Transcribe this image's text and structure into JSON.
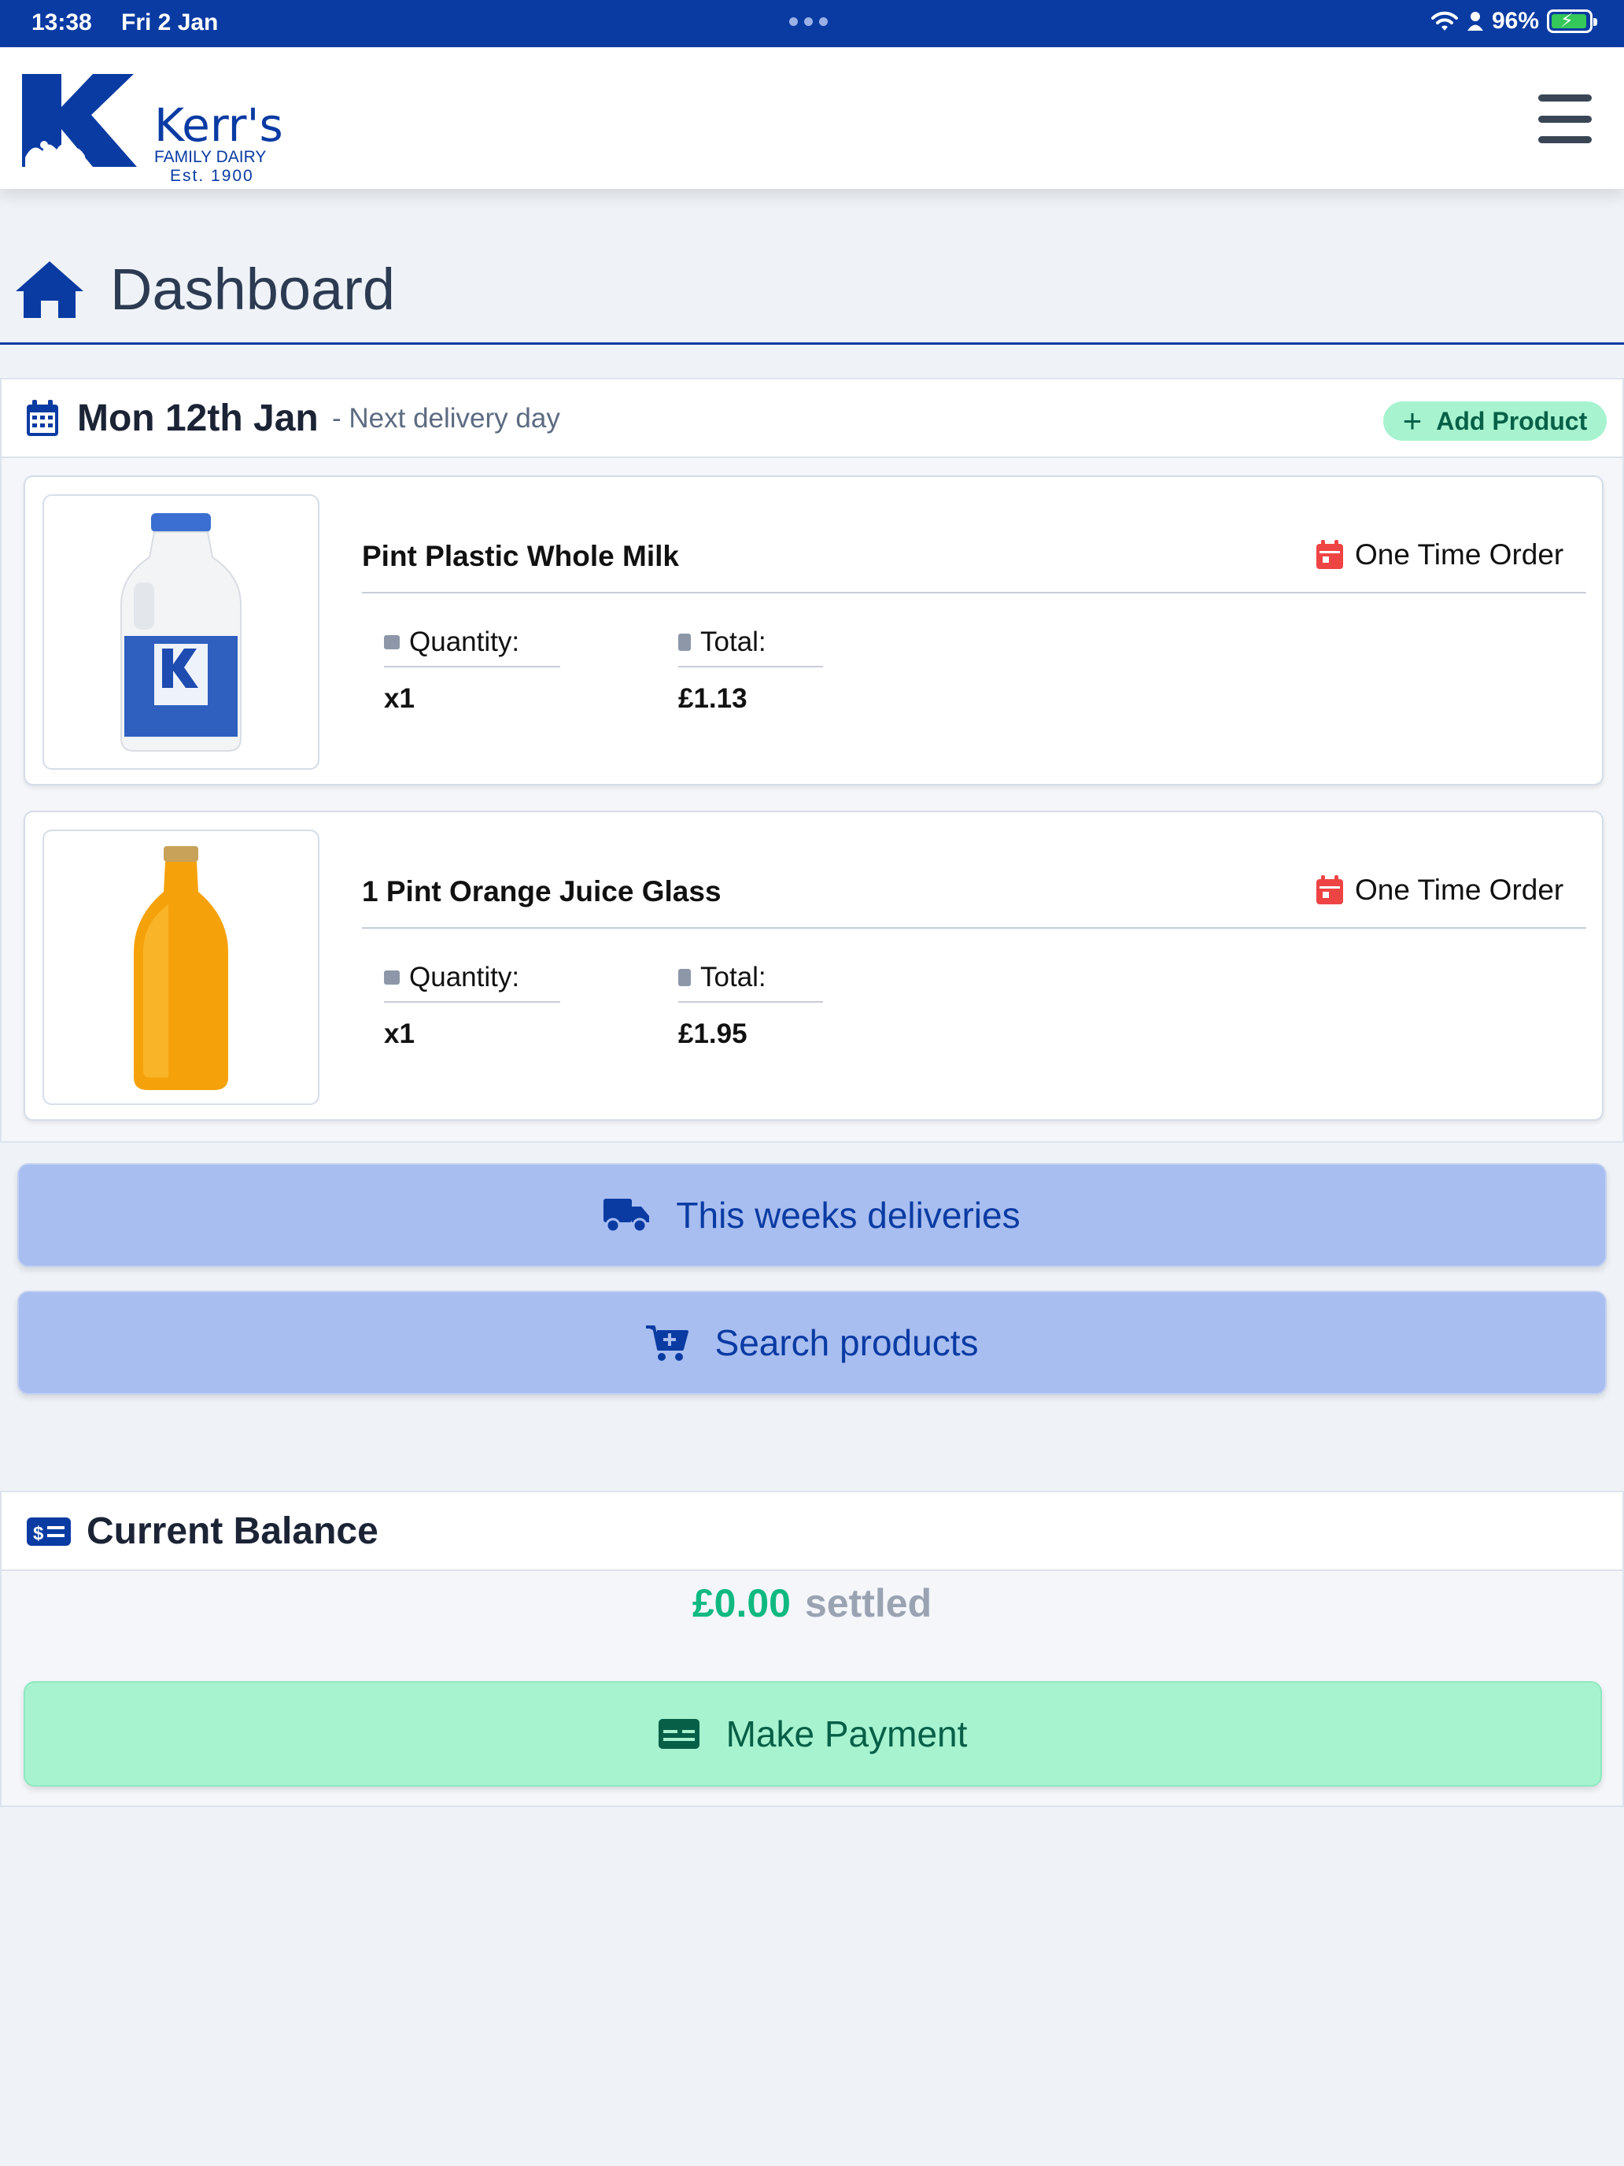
{
  "status_bar": {
    "time": "13:38",
    "date": "Fri 2 Jan",
    "battery": "96%",
    "icons": [
      "wifi-icon",
      "person-icon",
      "battery-charging-icon"
    ]
  },
  "brand": {
    "name": "Kerr's",
    "subtitle": "FAMILY DAIRY",
    "established": "Est. 1900",
    "color": "#0a3ba3"
  },
  "page": {
    "title": "Dashboard",
    "icon": "home-icon"
  },
  "next_delivery": {
    "date": "Mon 12th Jan",
    "subtitle": "- Next delivery day",
    "add_button": "Add Product",
    "products": [
      {
        "name": "Pint Plastic Whole Milk",
        "order_type": "One Time Order",
        "quantity_label": "Quantity:",
        "quantity": "x1",
        "total_label": "Total:",
        "total": "£1.13",
        "image": "milk-bottle"
      },
      {
        "name": "1 Pint Orange Juice Glass",
        "order_type": "One Time Order",
        "quantity_label": "Quantity:",
        "quantity": "x1",
        "total_label": "Total:",
        "total": "£1.95",
        "image": "orange-juice-bottle"
      }
    ]
  },
  "actions": {
    "deliveries": "This weeks deliveries",
    "search": "Search products"
  },
  "balance": {
    "title": "Current Balance",
    "amount": "£0.00",
    "status": "settled",
    "pay_button": "Make Payment"
  },
  "colors": {
    "primary": "#0a3ba3",
    "accent_green": "#10b981",
    "button_blue": "#a8bdf0",
    "button_green": "#a7f3d0",
    "order_red": "#ef4444"
  }
}
